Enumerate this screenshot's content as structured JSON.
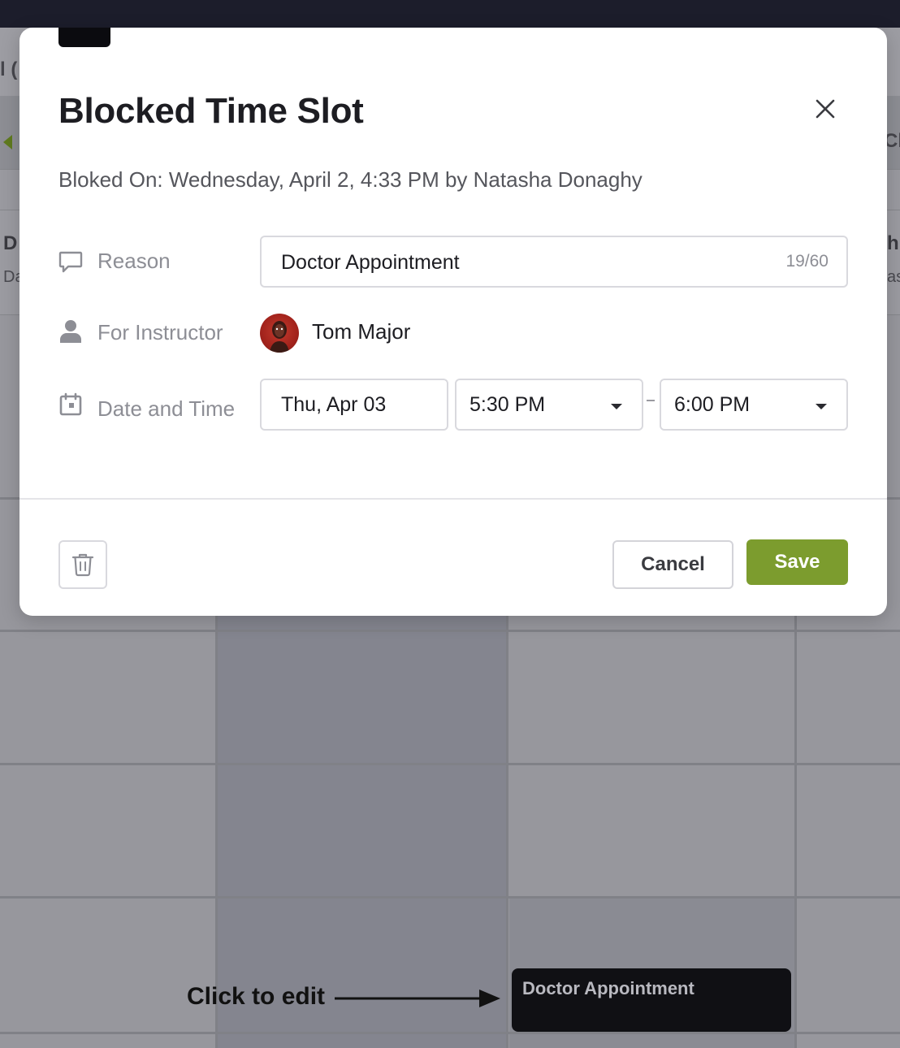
{
  "modal": {
    "title": "Blocked Time Slot",
    "subtitle": "Bloked On: Wednesday, April 2, 4:33 PM by Natasha Donaghy",
    "reason": {
      "label": "Reason",
      "value": "Doctor Appointment",
      "counter": "19/60"
    },
    "instructor": {
      "label": "For Instructor",
      "name": "Tom Major"
    },
    "datetime": {
      "label": "Date and Time",
      "date": "Thu, Apr 03",
      "start": "5:30 PM",
      "end": "6:00 PM"
    },
    "footer": {
      "cancel_label": "Cancel",
      "save_label": "Save"
    }
  },
  "background": {
    "header_fragment": "l (",
    "right_fragment": "Cla",
    "col1_title": "D",
    "col1_sub": "Da",
    "col_right_title": "h",
    "col_right_sub": "as",
    "event_chip": "Doctor Appointment"
  },
  "annotation": {
    "text": "Click to edit"
  },
  "colors": {
    "accent_green": "#7c9c2e",
    "topbar": "#1c1d2b",
    "chip_bg": "#101014"
  }
}
